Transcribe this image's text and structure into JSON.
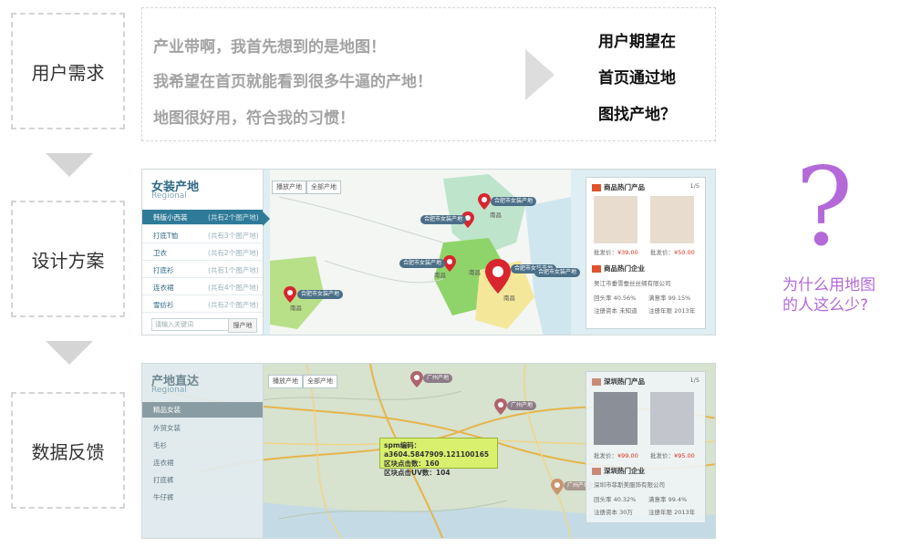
{
  "stages": [
    {
      "label": "用户需求"
    },
    {
      "label": "设计方案"
    },
    {
      "label": "数据反馈"
    }
  ],
  "requirements": {
    "quotes": [
      "产业带啊，我首先想到的是地图！",
      "我希望在首页就能看到很多牛逼的产地！",
      "地图很好用，符合我的习惯！"
    ],
    "expectation_lines": [
      "用户期望在",
      "首页通过地",
      "图找产地？"
    ]
  },
  "design_shot": {
    "title": "女装产地",
    "subtitle": "Regional",
    "tabs": [
      "播放产地",
      "全部产地"
    ],
    "categories": [
      {
        "label": "韩版小西装",
        "count": "(共有2个图产地)",
        "active": true
      },
      {
        "label": "打底T恤",
        "count": "(共有3个图产地)",
        "active": false
      },
      {
        "label": "卫衣",
        "count": "(共有2个图产地)",
        "active": false
      },
      {
        "label": "打底衫",
        "count": "(共有1个图产地)",
        "active": false
      },
      {
        "label": "连衣裙",
        "count": "(共有4个图产地)",
        "active": false
      },
      {
        "label": "雪纺衫",
        "count": "(共有2个图产地)",
        "active": false
      }
    ],
    "search_placeholder": "请输入关键词",
    "search_button": "搜产地",
    "cities": [
      "南昌",
      "南昌",
      "南昌",
      "南昌",
      "南昌",
      "南昌"
    ],
    "pin_labels": [
      "合肥市女装产地",
      "合肥市女装产地",
      "合肥市女装产地",
      "合肥市女装产地",
      "合肥市女装产地",
      "合肥市女装产地"
    ],
    "card": {
      "products_title": "商品热门产品",
      "pager": "1/5",
      "prices": [
        "¥39.00",
        "¥50.00"
      ],
      "price_label": "批发价：",
      "company_title": "商品热门企业",
      "company_name": "吴江市垂雪蚕丝丝绸有限公司",
      "stats": [
        "回头率 40.56%",
        "满意率 99.15%",
        "注册资本 未知道",
        "注册年限 2013年"
      ]
    }
  },
  "feedback_shot": {
    "title": "产地直达",
    "subtitle": "Regional",
    "tabs": [
      "播放产地",
      "全部产地"
    ],
    "categories": [
      {
        "label": "精品女装",
        "active": true
      },
      {
        "label": "外贸女装",
        "active": false
      },
      {
        "label": "毛衫",
        "active": false
      },
      {
        "label": "连衣裙",
        "active": false
      },
      {
        "label": "打底裤",
        "active": false
      },
      {
        "label": "牛仔裤",
        "active": false
      }
    ],
    "pin_labels": [
      "广州产地",
      "广州产地",
      "广州产地"
    ],
    "tooltip": {
      "line1": "spm编码：a3604.5847909.121100165",
      "line2": "区块点击数：160",
      "line3": "区块点击UV数：104"
    },
    "card": {
      "products_title": "深圳热门产品",
      "pager": "1/5",
      "prices": [
        "¥99.00",
        "¥95.00"
      ],
      "price_label": "批发价：",
      "company_title": "深圳热门企业",
      "company_name": "深圳市菲斯美服饰有限公司",
      "stats": [
        "回头率 40.32%",
        "满意率 99.4%",
        "注册资本 30万",
        "注册年限 2013年"
      ]
    }
  },
  "conclusion": {
    "symbol": "?",
    "lines": [
      "为什么用地图",
      "的人这么少?"
    ]
  },
  "colors": {
    "dashed_border": "#d4d4d4",
    "question_purple": "#b469d9",
    "sidebar_blue": "#2f7a98",
    "pin_red": "#d8252e",
    "tooltip_green": "#d8f06d"
  }
}
